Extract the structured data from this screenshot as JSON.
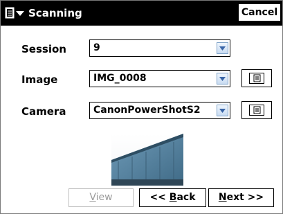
{
  "titlebar": {
    "title": "Scanning",
    "cancel_label": "Cancel"
  },
  "form": {
    "session": {
      "label": "Session",
      "value": "9"
    },
    "image": {
      "label": "Image",
      "value": "IMG_0008"
    },
    "camera": {
      "label": "Camera",
      "value": "CanonPowerShotS2"
    }
  },
  "buttons": {
    "view": {
      "pre": "",
      "mnemonic": "V",
      "post": "iew"
    },
    "back": {
      "pre": "<< ",
      "mnemonic": "B",
      "post": "ack"
    },
    "next": {
      "pre": "",
      "mnemonic": "N",
      "post": "ext >>"
    }
  },
  "colors": {
    "titlebar_bg": "#000000",
    "dropdown_arrow_bg": "#d6e6f7",
    "thumbnail_sky": "#ffffff",
    "thumbnail_building": "#5b86a3"
  },
  "icons": {
    "menu": "start-menu-icon",
    "dropdown": "chevron-down-icon",
    "browse": "document-icon"
  }
}
